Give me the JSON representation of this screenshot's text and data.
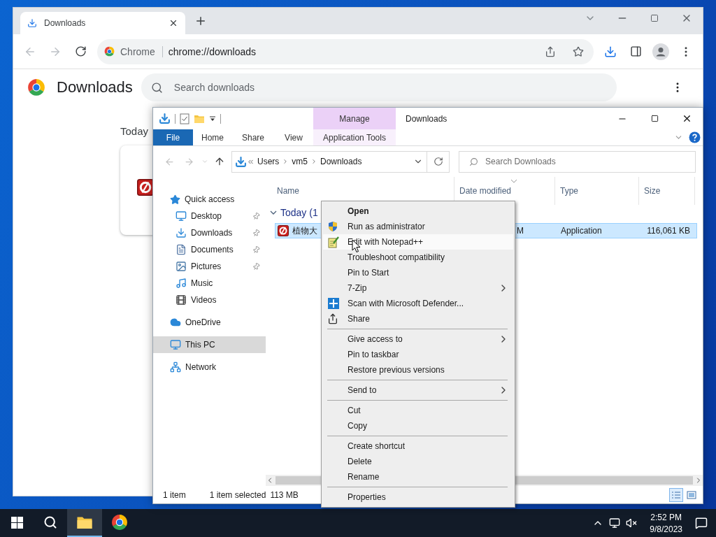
{
  "chrome": {
    "tab": {
      "title": "Downloads"
    },
    "omnibox": {
      "chip": "Chrome",
      "url": "chrome://downloads"
    },
    "page": {
      "title": "Downloads",
      "search": {
        "placeholder": "Search downloads"
      },
      "date_label": "Today"
    }
  },
  "explorer": {
    "title": "Downloads",
    "context_group": "Manage",
    "ribbon_tabs": [
      {
        "label": "File",
        "kind": "file"
      },
      {
        "label": "Home",
        "kind": "tab"
      },
      {
        "label": "Share",
        "kind": "tab"
      },
      {
        "label": "View",
        "kind": "tab"
      },
      {
        "label": "Application Tools",
        "kind": "contextual"
      }
    ],
    "breadcrumb": [
      "Users",
      "vm5",
      "Downloads"
    ],
    "search": {
      "placeholder": "Search Downloads"
    },
    "nav": [
      {
        "label": "Quick access",
        "selected": false,
        "children": [
          {
            "label": "Desktop",
            "pinned": true,
            "selected": false
          },
          {
            "label": "Downloads",
            "pinned": true,
            "selected": false
          },
          {
            "label": "Documents",
            "pinned": true,
            "selected": false
          },
          {
            "label": "Pictures",
            "pinned": true,
            "selected": false
          },
          {
            "label": "Music",
            "pinned": false,
            "selected": false
          },
          {
            "label": "Videos",
            "pinned": false,
            "selected": false
          }
        ]
      },
      {
        "label": "OneDrive",
        "selected": false
      },
      {
        "label": "This PC",
        "selected": true
      },
      {
        "label": "Network",
        "selected": false
      }
    ],
    "columns": [
      "Name",
      "Date modified",
      "Type",
      "Size"
    ],
    "group": {
      "label": "Today (1",
      "expanded": true
    },
    "rows": [
      {
        "name": "植物大",
        "date": "M",
        "type": "Application",
        "size": "116,061 KB",
        "selected": true
      }
    ],
    "status": {
      "count": "1 item",
      "selection": "1 item selected",
      "size": "113 MB"
    },
    "views": [
      {
        "selected": true
      },
      {
        "selected": false
      }
    ]
  },
  "context_menu": {
    "items": [
      {
        "kind": "item",
        "label": "Open",
        "default": true,
        "hovered": false,
        "submenu": false
      },
      {
        "kind": "item",
        "label": "Run as administrator",
        "default": false,
        "hovered": false,
        "submenu": false
      },
      {
        "kind": "item",
        "label": "Edit with Notepad++",
        "default": false,
        "hovered": true,
        "submenu": false
      },
      {
        "kind": "item",
        "label": "Troubleshoot compatibility",
        "default": false,
        "hovered": false,
        "submenu": false
      },
      {
        "kind": "item",
        "label": "Pin to Start",
        "default": false,
        "hovered": false,
        "submenu": false
      },
      {
        "kind": "item",
        "label": "7-Zip",
        "default": false,
        "hovered": false,
        "submenu": true
      },
      {
        "kind": "item",
        "label": "Scan with Microsoft Defender...",
        "default": false,
        "hovered": false,
        "submenu": false
      },
      {
        "kind": "item",
        "label": "Share",
        "default": false,
        "hovered": false,
        "submenu": false
      },
      {
        "kind": "separator"
      },
      {
        "kind": "item",
        "label": "Give access to",
        "default": false,
        "hovered": false,
        "submenu": true
      },
      {
        "kind": "item",
        "label": "Pin to taskbar",
        "default": false,
        "hovered": false,
        "submenu": false
      },
      {
        "kind": "item",
        "label": "Restore previous versions",
        "default": false,
        "hovered": false,
        "submenu": false
      },
      {
        "kind": "separator"
      },
      {
        "kind": "item",
        "label": "Send to",
        "default": false,
        "hovered": false,
        "submenu": true
      },
      {
        "kind": "separator"
      },
      {
        "kind": "item",
        "label": "Cut",
        "default": false,
        "hovered": false,
        "submenu": false
      },
      {
        "kind": "item",
        "label": "Copy",
        "default": false,
        "hovered": false,
        "submenu": false
      },
      {
        "kind": "separator"
      },
      {
        "kind": "item",
        "label": "Create shortcut",
        "default": false,
        "hovered": false,
        "submenu": false
      },
      {
        "kind": "item",
        "label": "Delete",
        "default": false,
        "hovered": false,
        "submenu": false
      },
      {
        "kind": "item",
        "label": "Rename",
        "default": false,
        "hovered": false,
        "submenu": false
      },
      {
        "kind": "separator"
      },
      {
        "kind": "item",
        "label": "Properties",
        "default": false,
        "hovered": false,
        "submenu": false
      }
    ]
  },
  "taskbar": {
    "apps": [
      {
        "selected": false
      },
      {
        "selected": true
      },
      {
        "selected": false
      }
    ],
    "clock": {
      "time": "2:52 PM",
      "date": "9/8/2023"
    }
  }
}
